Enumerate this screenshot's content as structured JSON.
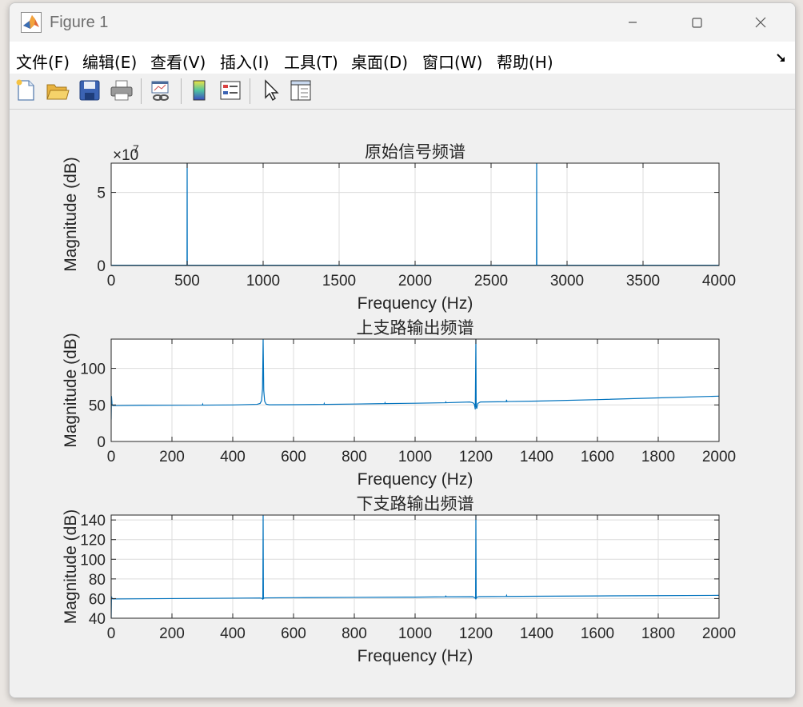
{
  "window": {
    "title": "Figure 1",
    "app_icon": "matlab-logo-icon",
    "controls": [
      "minimize-icon",
      "maximize-icon",
      "close-icon"
    ]
  },
  "menu": {
    "items": [
      "文件(F)",
      "编辑(E)",
      "查看(V)",
      "插入(I)",
      "工具(T)",
      "桌面(D)",
      "窗口(W)",
      "帮助(H)"
    ],
    "undock_icon": "undock-arrow-icon"
  },
  "toolbar": {
    "buttons": [
      {
        "icon": "new-figure-icon"
      },
      {
        "icon": "open-file-icon"
      },
      {
        "icon": "save-icon"
      },
      {
        "icon": "print-icon"
      },
      {
        "icon": "link-plot-icon"
      },
      {
        "icon": "colorbar-icon"
      },
      {
        "icon": "legend-icon"
      },
      {
        "icon": "edit-plot-arrow-icon"
      },
      {
        "icon": "property-inspector-icon"
      }
    ]
  },
  "colors": {
    "line": "#0072bd",
    "grid": "#dcdcdc",
    "axes_bg": "#ffffff",
    "figure_bg": "#f0f0f0",
    "text": "#262626"
  },
  "chart_data": [
    {
      "type": "line",
      "title": "原始信号频谱",
      "xlabel": "Frequency (Hz)",
      "ylabel": "Magnitude (dB)",
      "exponent_label": "×10",
      "exponent_power": "7",
      "xlim": [
        0,
        4000
      ],
      "ylim": [
        0,
        7
      ],
      "xticks": [
        0,
        500,
        1000,
        1500,
        2000,
        2500,
        3000,
        3500,
        4000
      ],
      "yticks": [
        0,
        5
      ],
      "grid": true,
      "series": [
        {
          "x": [
            0,
            499,
            500,
            501,
            2799,
            2800,
            2801,
            4000
          ],
          "y": [
            0.02,
            0.02,
            7.5,
            0.02,
            0.02,
            7.5,
            0.02,
            0.02
          ]
        }
      ]
    },
    {
      "type": "line",
      "title": "上支路输出频谱",
      "xlabel": "Frequency (Hz)",
      "ylabel": "Magnitude (dB)",
      "xlim": [
        0,
        2000
      ],
      "ylim": [
        0,
        140
      ],
      "xticks": [
        0,
        200,
        400,
        600,
        800,
        1000,
        1200,
        1400,
        1600,
        1800,
        2000
      ],
      "yticks": [
        0,
        50,
        100
      ],
      "grid": true,
      "series": [
        {
          "x": [
            0,
            1,
            3,
            5,
            100,
            300,
            301,
            302,
            400,
            480,
            490,
            495,
            498,
            500,
            502,
            505,
            510,
            520,
            600,
            700,
            701,
            702,
            800,
            900,
            901,
            902,
            1000,
            1100,
            1101,
            1102,
            1180,
            1190,
            1195,
            1198,
            1200,
            1201,
            1203,
            1206,
            1215,
            1300,
            1301,
            1302,
            1400,
            1600,
            1800,
            2000
          ],
          "y": [
            30,
            62,
            50,
            49,
            49.5,
            49.7,
            51,
            49.7,
            50,
            50.8,
            52,
            56,
            72,
            140,
            70,
            55,
            51,
            50.2,
            50.3,
            50.7,
            52,
            50.7,
            51.2,
            51.8,
            53,
            51.8,
            52.3,
            53,
            54,
            53,
            54,
            53,
            51,
            44,
            140,
            48,
            45,
            52,
            54,
            54.4,
            57,
            54.6,
            55.2,
            57.2,
            59.6,
            62
          ]
        }
      ]
    },
    {
      "type": "line",
      "title": "下支路输出频谱",
      "xlabel": "Frequency (Hz)",
      "ylabel": "Magnitude (dB)",
      "xlim": [
        0,
        2000
      ],
      "ylim": [
        40,
        145
      ],
      "xticks": [
        0,
        200,
        400,
        600,
        800,
        1000,
        1200,
        1400,
        1600,
        1800,
        2000
      ],
      "yticks": [
        40,
        60,
        80,
        100,
        120,
        140
      ],
      "grid": true,
      "series": [
        {
          "x": [
            0,
            1,
            3,
            5,
            100,
            300,
            400,
            490,
            497,
            499,
            500,
            501,
            503,
            510,
            600,
            800,
            1000,
            1100,
            1101,
            1102,
            1190,
            1197,
            1199,
            1200,
            1201,
            1203,
            1210,
            1300,
            1301,
            1302,
            1400,
            1600,
            1800,
            2000
          ],
          "y": [
            40,
            62,
            60,
            59.6,
            59.8,
            60.2,
            60.4,
            60.6,
            60.2,
            59,
            145,
            60,
            60.6,
            60.7,
            60.9,
            61.2,
            61.5,
            61.8,
            63,
            61.8,
            61.9,
            60.8,
            60,
            145,
            60.3,
            61.4,
            62,
            62.2,
            63.2,
            62.2,
            62.4,
            62.7,
            63,
            63.3
          ]
        }
      ]
    }
  ]
}
